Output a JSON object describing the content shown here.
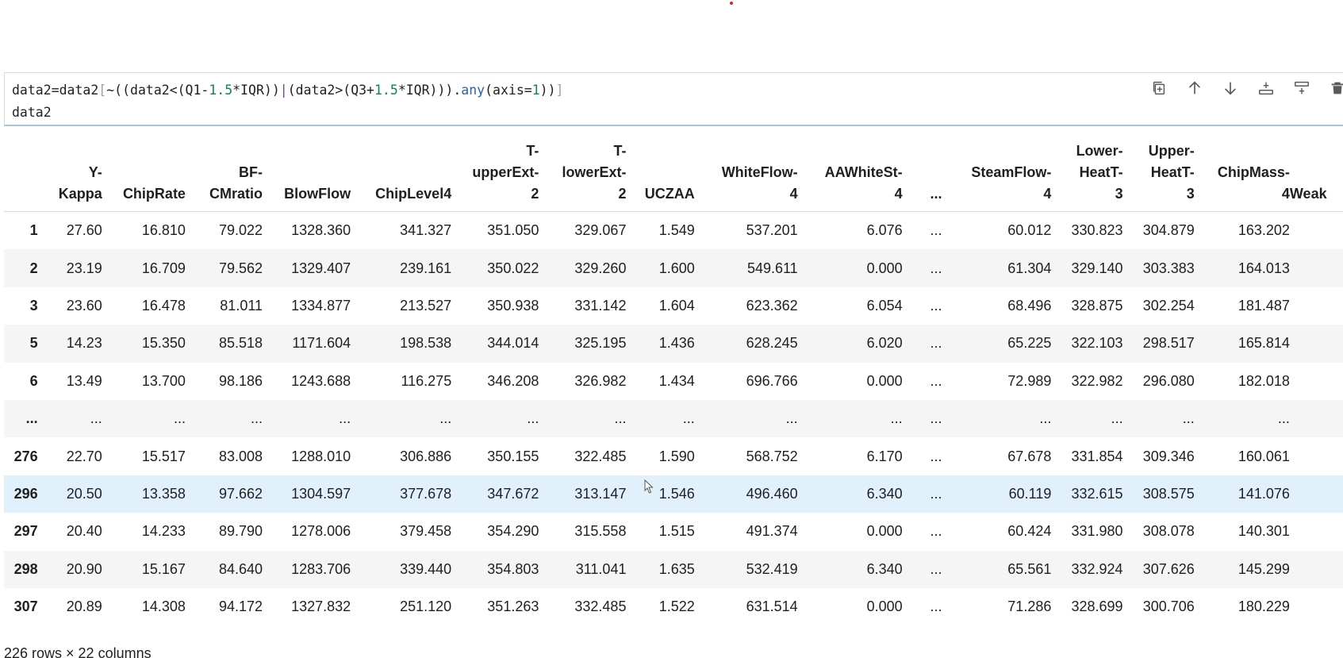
{
  "code": {
    "line1_parts": [
      "data2=data2",
      "[",
      "~((data2<(Q1-",
      "1.5",
      "*IQR))",
      "|",
      "(data2>(Q3+",
      "1.5",
      "*IQR))).",
      "any",
      "(axis=",
      "1",
      "))",
      "]"
    ],
    "line2": "data2"
  },
  "toolbar": {
    "copy": "duplicate-cell-icon",
    "up": "move-up-icon",
    "down": "move-down-icon",
    "insert_below": "insert-below-icon",
    "split": "split-cell-icon",
    "delete": "delete-icon"
  },
  "table": {
    "columns": [
      "",
      "Y-\nKappa",
      "ChipRate",
      "BF-\nCMratio",
      "BlowFlow",
      "ChipLevel4",
      "T-\nupperExt-\n2",
      "T-\nlowerExt-\n2",
      "UCZAA",
      "WhiteFlow-\n4",
      "AAWhiteSt-\n4",
      "...",
      "SteamFlow-\n4",
      "Lower-\nHeatT-\n3",
      "Upper-\nHeatT-\n3",
      "ChipMass-\n4",
      "Weak"
    ],
    "rows": [
      [
        "1",
        "27.60",
        "16.810",
        "79.022",
        "1328.360",
        "341.327",
        "351.050",
        "329.067",
        "1.549",
        "537.201",
        "6.076",
        "...",
        "60.012",
        "330.823",
        "304.879",
        "163.202",
        ""
      ],
      [
        "2",
        "23.19",
        "16.709",
        "79.562",
        "1329.407",
        "239.161",
        "350.022",
        "329.260",
        "1.600",
        "549.611",
        "0.000",
        "...",
        "61.304",
        "329.140",
        "303.383",
        "164.013",
        ""
      ],
      [
        "3",
        "23.60",
        "16.478",
        "81.011",
        "1334.877",
        "213.527",
        "350.938",
        "331.142",
        "1.604",
        "623.362",
        "6.054",
        "...",
        "68.496",
        "328.875",
        "302.254",
        "181.487",
        ""
      ],
      [
        "5",
        "14.23",
        "15.350",
        "85.518",
        "1171.604",
        "198.538",
        "344.014",
        "325.195",
        "1.436",
        "628.245",
        "6.020",
        "...",
        "65.225",
        "322.103",
        "298.517",
        "165.814",
        ""
      ],
      [
        "6",
        "13.49",
        "13.700",
        "98.186",
        "1243.688",
        "116.275",
        "346.208",
        "326.982",
        "1.434",
        "696.766",
        "0.000",
        "...",
        "72.989",
        "322.982",
        "296.080",
        "182.018",
        ""
      ],
      [
        "...",
        "...",
        "...",
        "...",
        "...",
        "...",
        "...",
        "...",
        "...",
        "...",
        "...",
        "...",
        "...",
        "...",
        "...",
        "...",
        ""
      ],
      [
        "276",
        "22.70",
        "15.517",
        "83.008",
        "1288.010",
        "306.886",
        "350.155",
        "322.485",
        "1.590",
        "568.752",
        "6.170",
        "...",
        "67.678",
        "331.854",
        "309.346",
        "160.061",
        ""
      ],
      [
        "296",
        "20.50",
        "13.358",
        "97.662",
        "1304.597",
        "377.678",
        "347.672",
        "313.147",
        "1.546",
        "496.460",
        "6.340",
        "...",
        "60.119",
        "332.615",
        "308.575",
        "141.076",
        ""
      ],
      [
        "297",
        "20.40",
        "14.233",
        "89.790",
        "1278.006",
        "379.458",
        "354.290",
        "315.558",
        "1.515",
        "491.374",
        "0.000",
        "...",
        "60.424",
        "331.980",
        "308.078",
        "140.301",
        ""
      ],
      [
        "298",
        "20.90",
        "15.167",
        "84.640",
        "1283.706",
        "339.440",
        "354.803",
        "311.041",
        "1.635",
        "532.419",
        "6.340",
        "...",
        "65.561",
        "332.924",
        "307.626",
        "145.299",
        ""
      ],
      [
        "307",
        "20.89",
        "14.308",
        "94.172",
        "1327.832",
        "251.120",
        "351.263",
        "332.485",
        "1.522",
        "631.514",
        "0.000",
        "...",
        "71.286",
        "328.699",
        "300.706",
        "180.229",
        ""
      ]
    ],
    "highlighted_row": 7
  },
  "footer": "226 rows × 22 columns"
}
